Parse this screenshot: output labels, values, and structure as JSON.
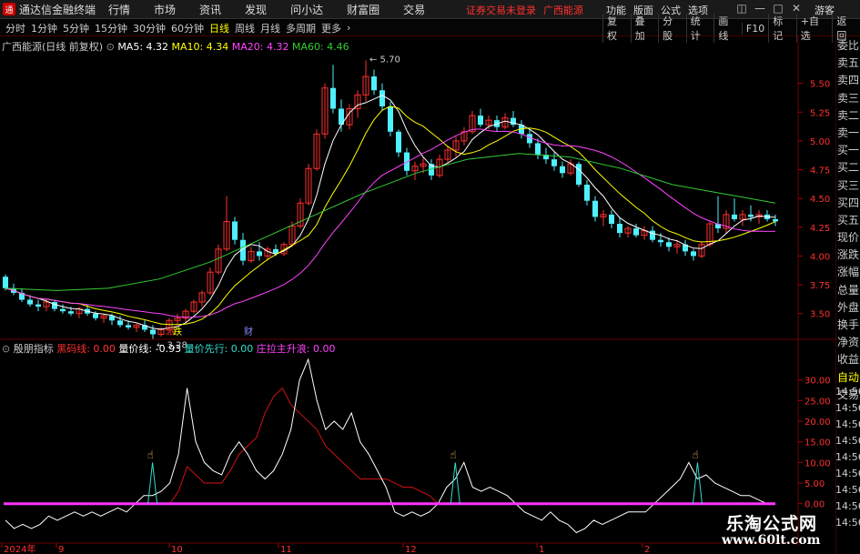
{
  "app": {
    "title": "通达信金融终端",
    "user": "游客"
  },
  "topmenu": [
    "行情",
    "市场",
    "资讯",
    "发现",
    "问小达",
    "财富圈",
    "交易"
  ],
  "notice": {
    "left": "证券交易未登录",
    "right": "广西能源"
  },
  "top_right": [
    "功能",
    "版面",
    "公式",
    "选项"
  ],
  "periods": [
    "分时",
    "1分钟",
    "5分钟",
    "15分钟",
    "30分钟",
    "60分钟",
    "日线",
    "周线",
    "月线",
    "多周期",
    "更多"
  ],
  "active_period": "日线",
  "toolbar_right": [
    "复权",
    "叠加",
    "分股",
    "统计",
    "画线",
    "F10",
    "标记",
    "+自选",
    "返回"
  ],
  "main_legend": {
    "title": "广西能源(日线 前复权)",
    "ma5": "MA5: 4.32",
    "ma10": "MA10: 4.34",
    "ma20": "MA20: 4.32",
    "ma60": "MA60: 4.46"
  },
  "main_annotations": {
    "high": "5.70",
    "low": "3.28",
    "event1": "派",
    "event1b": "跌",
    "event2": "财"
  },
  "main_y_ticks": [
    "5.50",
    "5.25",
    "5.00",
    "4.75",
    "4.50",
    "4.25",
    "4.00",
    "3.75",
    "3.50"
  ],
  "sub_legend": {
    "title": "殷朋指标",
    "l1": "黑码线: 0.00",
    "l2": "量价线: -0.93",
    "l3": "量价先行: 0.00",
    "l4": "庄拉主升浪: 0.00"
  },
  "sub_y_ticks": [
    "30.00",
    "25.00",
    "20.00",
    "15.00",
    "10.00",
    "5.00",
    "0.00"
  ],
  "x_ticks": [
    "2024年",
    "9",
    "10",
    "11",
    "12",
    "1",
    "2"
  ],
  "sidepanel": [
    "委比",
    "卖五",
    "卖四",
    "卖三",
    "卖二",
    "卖一",
    "买一",
    "买二",
    "买三",
    "买四",
    "买五",
    "现价",
    "涨跌",
    "涨幅",
    "总量",
    "外盘",
    "换手",
    "净资",
    "收益",
    "自动",
    "交易"
  ],
  "times": [
    "14:56",
    "14:56",
    "14:56",
    "14:56",
    "14:56",
    "14:56",
    "14:56",
    "14:56",
    "14:56"
  ],
  "watermark": {
    "line1": "乐淘公式网",
    "line2": "www.60lt.com"
  },
  "colors": {
    "up": "#ff3030",
    "down": "#4ff0ff",
    "ma5": "#ffffff",
    "ma10": "#ffff00",
    "ma20": "#ff44ff",
    "ma60": "#33cc33"
  },
  "chart_data": [
    {
      "type": "candlestick",
      "title": "广西能源(日线 前复权)",
      "ylim": [
        3.3,
        5.75
      ],
      "series_ohlc": [
        [
          3.82,
          3.84,
          3.7,
          3.72
        ],
        [
          3.72,
          3.76,
          3.66,
          3.68
        ],
        [
          3.68,
          3.72,
          3.6,
          3.62
        ],
        [
          3.62,
          3.66,
          3.56,
          3.58
        ],
        [
          3.58,
          3.62,
          3.52,
          3.56
        ],
        [
          3.56,
          3.62,
          3.52,
          3.6
        ],
        [
          3.6,
          3.62,
          3.52,
          3.54
        ],
        [
          3.54,
          3.58,
          3.5,
          3.52
        ],
        [
          3.52,
          3.56,
          3.48,
          3.5
        ],
        [
          3.5,
          3.56,
          3.46,
          3.54
        ],
        [
          3.54,
          3.58,
          3.48,
          3.5
        ],
        [
          3.5,
          3.52,
          3.44,
          3.46
        ],
        [
          3.46,
          3.5,
          3.42,
          3.48
        ],
        [
          3.48,
          3.5,
          3.4,
          3.44
        ],
        [
          3.44,
          3.48,
          3.38,
          3.4
        ],
        [
          3.4,
          3.44,
          3.36,
          3.38
        ],
        [
          3.38,
          3.42,
          3.34,
          3.4
        ],
        [
          3.4,
          3.44,
          3.34,
          3.36
        ],
        [
          3.36,
          3.4,
          3.28,
          3.32
        ],
        [
          3.32,
          3.38,
          3.3,
          3.36
        ],
        [
          3.36,
          3.46,
          3.34,
          3.44
        ],
        [
          3.44,
          3.5,
          3.4,
          3.46
        ],
        [
          3.46,
          3.54,
          3.42,
          3.52
        ],
        [
          3.52,
          3.62,
          3.5,
          3.6
        ],
        [
          3.6,
          3.7,
          3.56,
          3.68
        ],
        [
          3.68,
          3.9,
          3.66,
          3.86
        ],
        [
          3.86,
          4.1,
          3.84,
          4.06
        ],
        [
          4.06,
          4.52,
          4.04,
          4.3
        ],
        [
          4.3,
          4.34,
          4.1,
          4.14
        ],
        [
          4.14,
          4.2,
          3.92,
          3.96
        ],
        [
          3.96,
          4.08,
          3.94,
          4.04
        ],
        [
          4.04,
          4.12,
          3.96,
          4.0
        ],
        [
          4.0,
          4.08,
          3.96,
          4.06
        ],
        [
          4.06,
          4.1,
          4.0,
          4.02
        ],
        [
          4.02,
          4.12,
          4.0,
          4.1
        ],
        [
          4.1,
          4.3,
          4.08,
          4.26
        ],
        [
          4.26,
          4.5,
          4.24,
          4.46
        ],
        [
          4.46,
          4.8,
          4.44,
          4.76
        ],
        [
          4.76,
          5.1,
          4.74,
          5.06
        ],
        [
          5.06,
          5.5,
          5.02,
          5.46
        ],
        [
          5.46,
          5.66,
          5.24,
          5.28
        ],
        [
          5.28,
          5.36,
          5.08,
          5.14
        ],
        [
          5.14,
          5.32,
          5.1,
          5.28
        ],
        [
          5.28,
          5.44,
          5.2,
          5.4
        ],
        [
          5.4,
          5.7,
          5.34,
          5.56
        ],
        [
          5.56,
          5.62,
          5.4,
          5.44
        ],
        [
          5.44,
          5.5,
          5.26,
          5.3
        ],
        [
          5.3,
          5.34,
          5.04,
          5.08
        ],
        [
          5.08,
          5.1,
          4.86,
          4.9
        ],
        [
          4.9,
          4.94,
          4.7,
          4.74
        ],
        [
          4.74,
          4.82,
          4.66,
          4.78
        ],
        [
          4.78,
          4.86,
          4.72,
          4.8
        ],
        [
          4.8,
          4.84,
          4.66,
          4.7
        ],
        [
          4.7,
          4.88,
          4.68,
          4.84
        ],
        [
          4.84,
          4.96,
          4.8,
          4.92
        ],
        [
          4.92,
          5.04,
          4.86,
          5.0
        ],
        [
          5.0,
          5.12,
          4.96,
          5.08
        ],
        [
          5.08,
          5.26,
          5.06,
          5.22
        ],
        [
          5.22,
          5.28,
          5.12,
          5.14
        ],
        [
          5.14,
          5.22,
          5.1,
          5.18
        ],
        [
          5.18,
          5.22,
          5.08,
          5.12
        ],
        [
          5.12,
          5.24,
          5.1,
          5.2
        ],
        [
          5.2,
          5.26,
          5.12,
          5.14
        ],
        [
          5.14,
          5.18,
          5.02,
          5.06
        ],
        [
          5.06,
          5.1,
          4.94,
          4.98
        ],
        [
          4.98,
          5.02,
          4.84,
          4.88
        ],
        [
          4.88,
          4.94,
          4.8,
          4.84
        ],
        [
          4.84,
          4.9,
          4.74,
          4.78
        ],
        [
          4.78,
          4.82,
          4.68,
          4.72
        ],
        [
          4.72,
          4.84,
          4.7,
          4.8
        ],
        [
          4.8,
          4.82,
          4.6,
          4.62
        ],
        [
          4.62,
          4.66,
          4.44,
          4.48
        ],
        [
          4.48,
          4.52,
          4.3,
          4.34
        ],
        [
          4.34,
          4.4,
          4.26,
          4.36
        ],
        [
          4.36,
          4.4,
          4.24,
          4.28
        ],
        [
          4.28,
          4.34,
          4.16,
          4.2
        ],
        [
          4.2,
          4.26,
          4.16,
          4.24
        ],
        [
          4.24,
          4.28,
          4.16,
          4.18
        ],
        [
          4.18,
          4.26,
          4.14,
          4.22
        ],
        [
          4.22,
          4.26,
          4.12,
          4.14
        ],
        [
          4.14,
          4.2,
          4.08,
          4.12
        ],
        [
          4.12,
          4.16,
          4.04,
          4.08
        ],
        [
          4.08,
          4.14,
          4.02,
          4.1
        ],
        [
          4.1,
          4.14,
          4.0,
          4.04
        ],
        [
          4.04,
          4.06,
          3.96,
          4.0
        ],
        [
          4.0,
          4.12,
          3.98,
          4.1
        ],
        [
          4.1,
          4.3,
          4.08,
          4.28
        ],
        [
          4.28,
          4.52,
          4.2,
          4.24
        ],
        [
          4.24,
          4.4,
          4.2,
          4.36
        ],
        [
          4.36,
          4.5,
          4.3,
          4.32
        ],
        [
          4.32,
          4.4,
          4.26,
          4.36
        ],
        [
          4.36,
          4.44,
          4.3,
          4.34
        ],
        [
          4.34,
          4.4,
          4.28,
          4.36
        ],
        [
          4.36,
          4.4,
          4.3,
          4.32
        ],
        [
          4.32,
          4.36,
          4.26,
          4.3
        ]
      ],
      "ma60_y": [
        3.72,
        3.7,
        3.72,
        3.8,
        3.95,
        4.15,
        4.35,
        4.55,
        4.72,
        4.84,
        4.89,
        4.86,
        4.76,
        4.62,
        4.54,
        4.46
      ]
    },
    {
      "type": "line",
      "title": "殷朋指标",
      "ylim": [
        -8,
        35
      ],
      "series": [
        {
          "name": "量价线",
          "values": [
            -4,
            -6,
            -5,
            -6,
            -5,
            -3,
            -4,
            -3,
            -2,
            -3,
            -2,
            -3,
            -2,
            -1,
            -2,
            0,
            2,
            2,
            3,
            5,
            12,
            28,
            15,
            10,
            8,
            7,
            12,
            15,
            12,
            8,
            6,
            8,
            12,
            18,
            30,
            35,
            25,
            18,
            20,
            18,
            22,
            15,
            12,
            8,
            4,
            -2,
            -3,
            -2,
            -3,
            -2,
            0,
            4,
            6,
            10,
            4,
            3,
            4,
            3,
            2,
            0,
            -2,
            -3,
            -4,
            -2,
            -4,
            -5,
            -7,
            -6,
            -4,
            -5,
            -4,
            -3,
            -2,
            -2,
            -2,
            0,
            2,
            4,
            6,
            10,
            6,
            7,
            5,
            4,
            3,
            2,
            2,
            1,
            0,
            0
          ]
        },
        {
          "name": "黑码线",
          "values": [
            0,
            0,
            0,
            0,
            0,
            0,
            0,
            0,
            0,
            0,
            0,
            0,
            0,
            0,
            0,
            0,
            0,
            0,
            0,
            0,
            3,
            9,
            7,
            5,
            5,
            5,
            8,
            12,
            14,
            16,
            22,
            26,
            28,
            24,
            22,
            20,
            18,
            14,
            12,
            10,
            8,
            6,
            6,
            6,
            6,
            5,
            4,
            4,
            3,
            2,
            0,
            0,
            0,
            0,
            0,
            0,
            0,
            0,
            0,
            0,
            0,
            0,
            0,
            0,
            0,
            0,
            0,
            0,
            0,
            0,
            0,
            0,
            0,
            0,
            0,
            0,
            0,
            0,
            0,
            0,
            0,
            0,
            0,
            0,
            0,
            0,
            0,
            0,
            0,
            0
          ]
        }
      ]
    }
  ]
}
